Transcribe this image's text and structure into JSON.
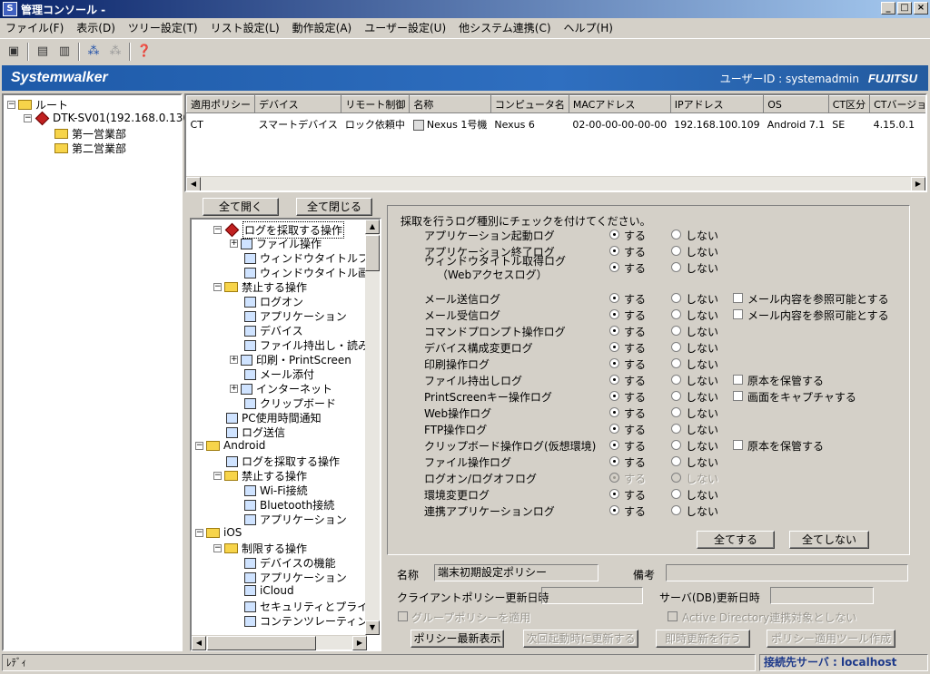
{
  "window": {
    "title": "管理コンソール -"
  },
  "menu": [
    "ファイル(F)",
    "表示(D)",
    "ツリー設定(T)",
    "リスト設定(L)",
    "動作設定(A)",
    "ユーザー設定(U)",
    "他システム連携(C)",
    "ヘルプ(H)"
  ],
  "brand": {
    "logo": "Systemwalker",
    "user": "ユーザーID : systemadmin",
    "vendor": "FUJITSU"
  },
  "left_tree": {
    "root": "ルート",
    "server": "DTK-SV01(192.168.0.130)",
    "children": [
      "第一営業部",
      "第二営業部"
    ]
  },
  "grid": {
    "columns": [
      "適用ポリシー",
      "デバイス",
      "リモート制御",
      "名称",
      "コンピュータ名",
      "MACアドレス",
      "IPアドレス",
      "OS",
      "CT区分",
      "CTバージョ"
    ],
    "rows": [
      [
        "CT",
        "スマートデバイス",
        "ロック依頼中",
        "Nexus 1号機",
        "Nexus 6",
        "02-00-00-00-00-00",
        "192.168.100.109",
        "Android 7.1",
        "SE",
        "4.15.0.1"
      ]
    ]
  },
  "buttons": {
    "expand_all": "全て開く",
    "collapse_all": "全て閉じる",
    "all_yes": "全てする",
    "all_no": "全てしない",
    "latest_policy": "ポリシー最新表示",
    "update_next_boot": "次回起動時に更新する",
    "update_now": "即時更新を行う",
    "create_tool": "ポリシー適用ツール作成"
  },
  "policy_tree": [
    "ログを採取する操作",
    "ファイル操作",
    "ウィンドウタイトルフィル",
    "ウィンドウタイトル画面=",
    "禁止する操作",
    "ログオン",
    "アプリケーション",
    "デバイス",
    "ファイル持出し・読み込",
    "印刷・PrintScreen",
    "メール添付",
    "インターネット",
    "クリップボード",
    "PC使用時間通知",
    "ログ送信",
    "Android",
    "ログを採取する操作",
    "禁止する操作",
    "Wi-Fi接続",
    "Bluetooth接続",
    "アプリケーション",
    "iOS",
    "制限する操作",
    "デバイスの機能",
    "アプリケーション",
    "iCloud",
    "セキュリティとプライバシ",
    "コンテンツレーティング"
  ],
  "log_panel": {
    "instruction": "採取を行うログ種別にチェックを付けてください。",
    "yes_label": "する",
    "no_label": "しない",
    "rows": [
      {
        "name": "アプリケーション起動ログ",
        "value": "yes"
      },
      {
        "name": "アプリケーション終了ログ",
        "value": "yes"
      },
      {
        "name": "ウィンドウタイトル取得ログ",
        "name2": "（Webアクセスログ）",
        "value": "yes"
      },
      {
        "name": "メール送信ログ",
        "value": "yes",
        "option": "メール内容を参照可能とする"
      },
      {
        "name": "メール受信ログ",
        "value": "yes",
        "option": "メール内容を参照可能とする"
      },
      {
        "name": "コマンドプロンプト操作ログ",
        "value": "yes"
      },
      {
        "name": "デバイス構成変更ログ",
        "value": "yes"
      },
      {
        "name": "印刷操作ログ",
        "value": "yes"
      },
      {
        "name": "ファイル持出しログ",
        "value": "yes",
        "option": "原本を保管する"
      },
      {
        "name": "PrintScreenキー操作ログ",
        "value": "yes",
        "option": "画面をキャプチャする"
      },
      {
        "name": "Web操作ログ",
        "value": "yes"
      },
      {
        "name": "FTP操作ログ",
        "value": "yes"
      },
      {
        "name": "クリップボード操作ログ(仮想環境)",
        "value": "yes",
        "option": "原本を保管する"
      },
      {
        "name": "ファイル操作ログ",
        "value": "yes"
      },
      {
        "name": "ログオン/ログオフログ",
        "value": "yes",
        "disabled": true
      },
      {
        "name": "環境変更ログ",
        "value": "yes"
      },
      {
        "name": "連携アプリケーションログ",
        "value": "yes"
      }
    ]
  },
  "form": {
    "name_label": "名称",
    "name_value": "端末初期設定ポリシー",
    "note_label": "備考",
    "note_value": "",
    "client_update_label": "クライアントポリシー更新日時",
    "client_update_value": "",
    "server_update_label": "サーバ(DB)更新日時",
    "server_update_value": "",
    "group_policy_label": "グループポリシーを適用",
    "ad_label": "Active Directory連携対象としない"
  },
  "status": {
    "left": "ﾚﾃﾞｨ",
    "right": "接続先サーバ : localhost"
  }
}
